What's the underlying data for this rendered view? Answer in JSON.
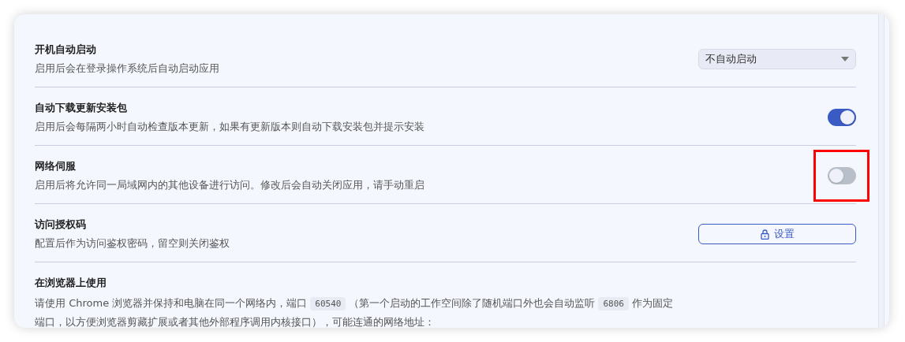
{
  "settings": [
    {
      "kind": "select",
      "title": "开机自动启动",
      "description": "启用后会在登录操作系统后自动启动应用",
      "value": "不自动启动",
      "highlighted": false
    },
    {
      "kind": "toggle",
      "title": "自动下载更新安装包",
      "description": "启用后会每隔两小时自动检查版本更新，如果有更新版本则自动下载安装包并提示安装",
      "on": true,
      "highlighted": false
    },
    {
      "kind": "toggle",
      "title": "网络伺服",
      "description": "启用后将允许同一局域网内的其他设备进行访问。修改后会自动关闭应用，请手动重启",
      "on": false,
      "highlighted": true
    },
    {
      "kind": "button",
      "title": "访问授权码",
      "description": "配置后作为访问鉴权密码，留空则关闭鉴权",
      "button": "设置",
      "highlighted": false
    },
    {
      "kind": "info",
      "title": "在浏览器上使用",
      "segments": [
        {
          "kind": "text",
          "text": "请使用 Chrome 浏览器并保持和电脑在同一个网络内，端口"
        },
        {
          "kind": "code",
          "text": "60540"
        },
        {
          "kind": "text",
          "text": "（第一个启动的工作空间除了随机端口外也会自动监听"
        },
        {
          "kind": "code",
          "text": "6806"
        },
        {
          "kind": "text",
          "text": "作为固定端口，以方便浏览器剪藏扩展或者其他外部程序调用内核接口），可能连通的网络地址："
        }
      ],
      "highlighted": false
    }
  ]
}
